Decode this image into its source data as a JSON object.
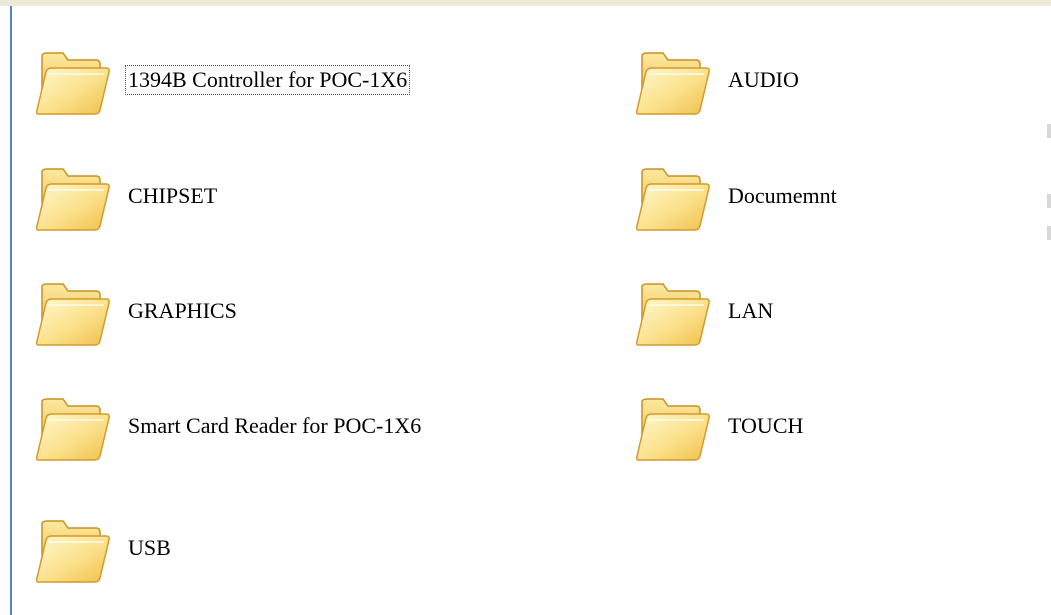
{
  "folders": [
    {
      "label": "1394B Controller for POC-1X6",
      "icon": "folder-icon",
      "focused": true
    },
    {
      "label": "AUDIO",
      "icon": "folder-icon"
    },
    {
      "label": "CHIPSET",
      "icon": "folder-icon"
    },
    {
      "label": "Documemnt",
      "icon": "folder-icon"
    },
    {
      "label": "GRAPHICS",
      "icon": "folder-icon"
    },
    {
      "label": "LAN",
      "icon": "folder-icon"
    },
    {
      "label": "Smart Card Reader for POC-1X6",
      "icon": "folder-icon"
    },
    {
      "label": "TOUCH",
      "icon": "folder-icon"
    },
    {
      "label": "USB",
      "icon": "folder-icon"
    }
  ],
  "colors": {
    "folder_light": "#fff6c2",
    "folder_mid": "#f9dc79",
    "folder_dark": "#d99a1f",
    "border_blue": "#5a7edc",
    "chrome": "#ece9d8"
  }
}
